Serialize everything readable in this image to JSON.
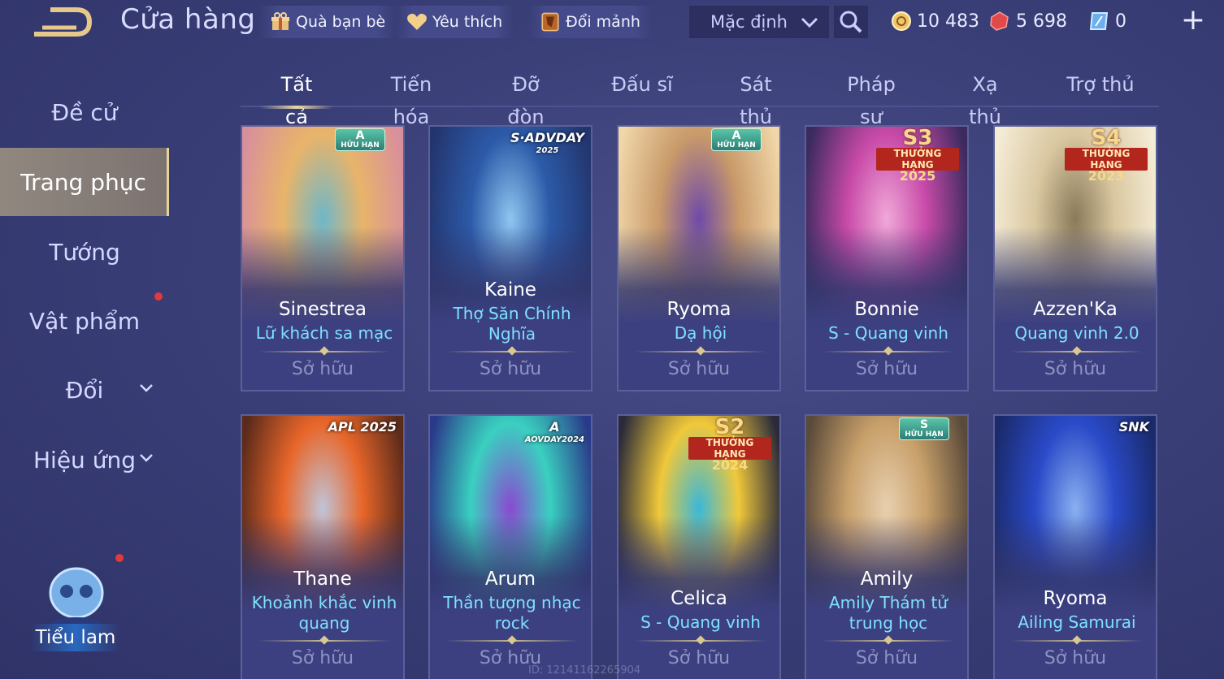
{
  "header": {
    "title": "Cửa hàng",
    "buttons": [
      {
        "label": "Quà bạn bè",
        "icon": "gift-icon"
      },
      {
        "label": "Yêu thích",
        "icon": "heart-icon"
      },
      {
        "label": "Đổi mảnh",
        "icon": "shard-icon"
      }
    ],
    "sort_value": "Mặc định",
    "currencies": [
      {
        "icon": "gold-coin-icon",
        "value": "10 483"
      },
      {
        "icon": "ruby-icon",
        "value": "5 698"
      },
      {
        "icon": "voucher-icon",
        "value": "0"
      }
    ],
    "plus": "+"
  },
  "sidebar": {
    "items": [
      {
        "label": "Đề cử"
      },
      {
        "label": "Trang phục"
      },
      {
        "label": "Tướng"
      },
      {
        "label": "Vật phẩm"
      },
      {
        "label": "Đổi"
      },
      {
        "label": "Hiệu ứng"
      }
    ],
    "active": "Trang phục",
    "avatar_label": "Tiểu lam"
  },
  "tabs": [
    "Tất cả",
    "Tiến hóa",
    "Đỡ đòn",
    "Đấu sĩ",
    "Sát thủ",
    "Pháp sư",
    "Xạ thủ",
    "Trợ thủ"
  ],
  "active_tab": "Tất cả",
  "cards": [
    {
      "hero": "Sinestrea",
      "skin": "Lữ khách sa mạc",
      "status": "Sở hữu",
      "badge": {
        "type": "A",
        "line1": "A",
        "line2": "HỮU HẠN"
      },
      "colors": [
        "#e8b46a",
        "#6fb7c9",
        "#d88f9c"
      ]
    },
    {
      "hero": "Kaine",
      "skin": "Thợ Săn Chính Nghĩa",
      "status": "Sở hữu",
      "badge": {
        "type": "text",
        "line1": "S·ADVDAY",
        "line2": "2025"
      },
      "colors": [
        "#2c5aa8",
        "#8ec6f0",
        "#23356e"
      ]
    },
    {
      "hero": "Ryoma",
      "skin": "Dạ hội",
      "status": "Sở hữu",
      "badge": {
        "type": "A",
        "line1": "A",
        "line2": "HỮU HẠN"
      },
      "colors": [
        "#c99a6a",
        "#6e4aa8",
        "#f0d6a8"
      ]
    },
    {
      "hero": "Bonnie",
      "skin": "S - Quang vinh",
      "status": "Sở hữu",
      "badge": {
        "type": "T",
        "line1": "S3",
        "line2": "THƯỞNG HẠNG",
        "line3": "2025"
      },
      "colors": [
        "#c84aa8",
        "#f0a8d8",
        "#3a2a5e"
      ]
    },
    {
      "hero": "Azzen'Ka",
      "skin": "Quang vinh 2.0",
      "status": "Sở hữu",
      "badge": {
        "type": "T",
        "line1": "S4",
        "line2": "THƯỞNG HẠNG",
        "line3": "2023"
      },
      "colors": [
        "#d9c7a0",
        "#8a7a5a",
        "#f5ecd6"
      ]
    },
    {
      "hero": "Thane",
      "skin": "Khoảnh khắc vinh quang",
      "status": "Sở hữu",
      "badge": {
        "type": "text",
        "line1": "APL 2025",
        "line2": ""
      },
      "colors": [
        "#e8662a",
        "#c0c4d8",
        "#5a2a1a"
      ]
    },
    {
      "hero": "Arum",
      "skin": "Thần tượng nhạc rock",
      "status": "Sở hữu",
      "badge": {
        "type": "text",
        "line1": "A",
        "line2": "AOVDAY2024"
      },
      "colors": [
        "#3ad0c0",
        "#8a4ad0",
        "#2a3a8a"
      ]
    },
    {
      "hero": "Celica",
      "skin": "S - Quang vinh",
      "status": "Sở hữu",
      "badge": {
        "type": "T",
        "line1": "S2",
        "line2": "THƯỞNG HẠNG",
        "line3": "2024"
      },
      "colors": [
        "#f0c83a",
        "#3ab8d8",
        "#2a2a3a"
      ]
    },
    {
      "hero": "Amily",
      "skin": "Amily Thám tử trung học",
      "status": "Sở hữu",
      "badge": {
        "type": "A",
        "line1": "S",
        "line2": "HỮU HẠN"
      },
      "colors": [
        "#c8a06a",
        "#e8d0b0",
        "#5a4a3a"
      ]
    },
    {
      "hero": "Ryoma",
      "skin": "Ailing Samurai",
      "status": "Sở hữu",
      "badge": {
        "type": "text",
        "line1": "SNK",
        "line2": ""
      },
      "colors": [
        "#2a4ac8",
        "#8ab0f0",
        "#1a2a6a"
      ]
    }
  ],
  "footer_id": "ID: 12141162265904"
}
